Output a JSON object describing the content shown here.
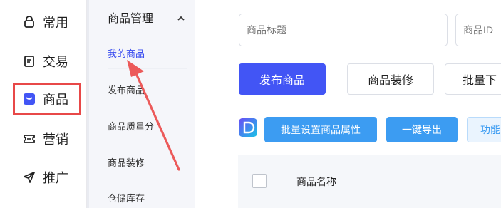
{
  "nav": {
    "items": [
      {
        "label": "常用",
        "icon": "bag-icon"
      },
      {
        "label": "交易",
        "icon": "document-icon"
      },
      {
        "label": "商品",
        "icon": "product-icon",
        "active": true
      },
      {
        "label": "营销",
        "icon": "ticket-icon"
      },
      {
        "label": "推广",
        "icon": "send-icon"
      }
    ]
  },
  "subnav": {
    "title": "商品管理",
    "items": [
      {
        "label": "我的商品",
        "active": true
      },
      {
        "label": "发布商品"
      },
      {
        "label": "商品质量分"
      },
      {
        "label": "商品装修"
      },
      {
        "label": "仓储库存"
      }
    ]
  },
  "search": {
    "title_placeholder": "商品标题",
    "id_placeholder": "商品ID"
  },
  "actions": {
    "publish": "发布商品",
    "decorate": "商品装修",
    "batch": "批量下"
  },
  "toolbar": {
    "batch_attr": "批量设置商品属性",
    "export": "一键导出",
    "features": "功能"
  },
  "table": {
    "col_name": "商品名称"
  },
  "colors": {
    "primary": "#4255f5",
    "secondary": "#3c9cf2",
    "highlight": "#e84848"
  }
}
